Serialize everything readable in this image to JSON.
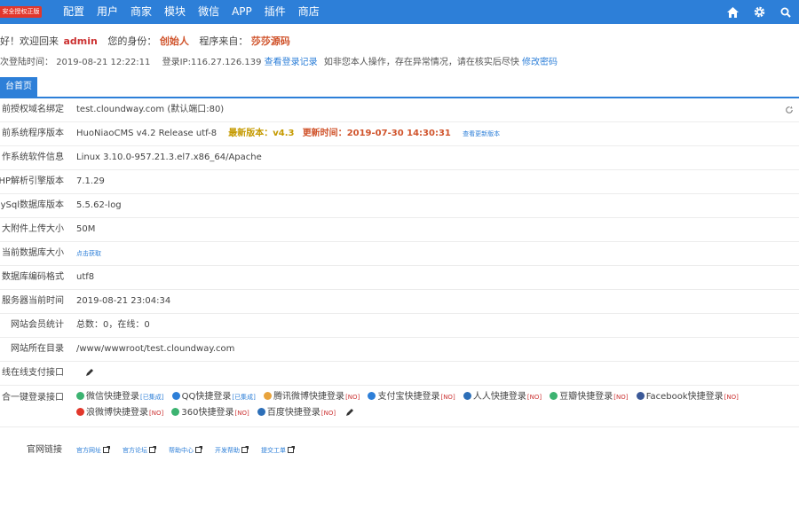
{
  "header": {
    "badge": "安全授权正版",
    "nav": [
      "配置",
      "用户",
      "商家",
      "模块",
      "微信",
      "APP",
      "插件",
      "商店"
    ],
    "icons": [
      "home-icon",
      "gear-icon",
      "search-icon"
    ]
  },
  "welcome": {
    "greeting": "好！欢迎回来",
    "username": "admin",
    "role_label": "您的身份：",
    "role": "创始人",
    "source_label": "程序来自：",
    "source": "莎莎源码"
  },
  "login_info": {
    "time_label": "次登陆时间：",
    "time": "2019-08-21 12:22:11",
    "ip_label": "登录IP:",
    "ip": "116.27.126.139",
    "view_records": "查看登录记录",
    "warning": "如非您本人操作，存在异常情况，请在核实后尽快",
    "change_password": "修改密码"
  },
  "tabs": {
    "active": "台首页"
  },
  "system": {
    "domain": {
      "label": "前授权域名绑定",
      "value": "test.cloundway.com (默认端口:80)"
    },
    "version": {
      "label": "前系统程序版本",
      "value": "HuoNiaoCMS v4.2 Release utf-8",
      "new_label": "最新版本：",
      "new_version": "v4.3",
      "update_label": "更新时间：",
      "update_date": "2019-07-30 14:30:31",
      "view_log": "查看更新版本"
    },
    "os": {
      "label": "作系统软件信息",
      "value": "Linux 3.10.0-957.21.3.el7.x86_64/Apache"
    },
    "php": {
      "label": "HP解析引擎版本",
      "value": "7.1.29"
    },
    "mysql": {
      "label": "ySql数据库版本",
      "value": "5.5.62-log"
    },
    "upload": {
      "label": "大附件上传大小",
      "value": "50M"
    },
    "db_size": {
      "label": "当前数据库大小",
      "value": "点击获取"
    },
    "encoding": {
      "label": "数据库编码格式",
      "value": "utf8"
    },
    "server_time": {
      "label": "服务器当前时间",
      "value": "2019-08-21 23:04:34"
    },
    "members": {
      "label": "网站会员统计",
      "value": "总数：0，在线：0"
    },
    "root": {
      "label": "网站所在目录",
      "value": "/www/wwwroot/test.cloundway.com"
    },
    "payment": {
      "label": "线在线支付接口"
    },
    "oauth": {
      "label": "合一键登录接口",
      "items": [
        {
          "name": "微信快捷登录",
          "tag": "[已集成]",
          "color": "#3cb371"
        },
        {
          "name": "QQ快捷登录",
          "tag": "[已集成]",
          "color": "#2d7fd8"
        },
        {
          "name": "腾讯微博快捷登录",
          "tag": "[NO]",
          "color": "#e8a33c"
        },
        {
          "name": "支付宝快捷登录",
          "tag": "[NO]",
          "color": "#2d7fd8"
        },
        {
          "name": "人人快捷登录",
          "tag": "[NO]",
          "color": "#2d6fb8"
        },
        {
          "name": "豆瓣快捷登录",
          "tag": "[NO]",
          "color": "#3cb371"
        },
        {
          "name": "Facebook快捷登录",
          "tag": "[NO]",
          "color": "#3b5998"
        },
        {
          "name": "浪微博快捷登录",
          "tag": "[NO]",
          "color": "#e2372b"
        },
        {
          "name": "360快捷登录",
          "tag": "[NO]",
          "color": "#3cb371"
        },
        {
          "name": "百度快捷登录",
          "tag": "[NO]",
          "color": "#2d6fb8"
        }
      ]
    }
  },
  "official": {
    "label": "官网链接",
    "links": [
      "官方网址",
      "官方论坛",
      "帮助中心",
      "开发帮助",
      "提交工单"
    ]
  }
}
